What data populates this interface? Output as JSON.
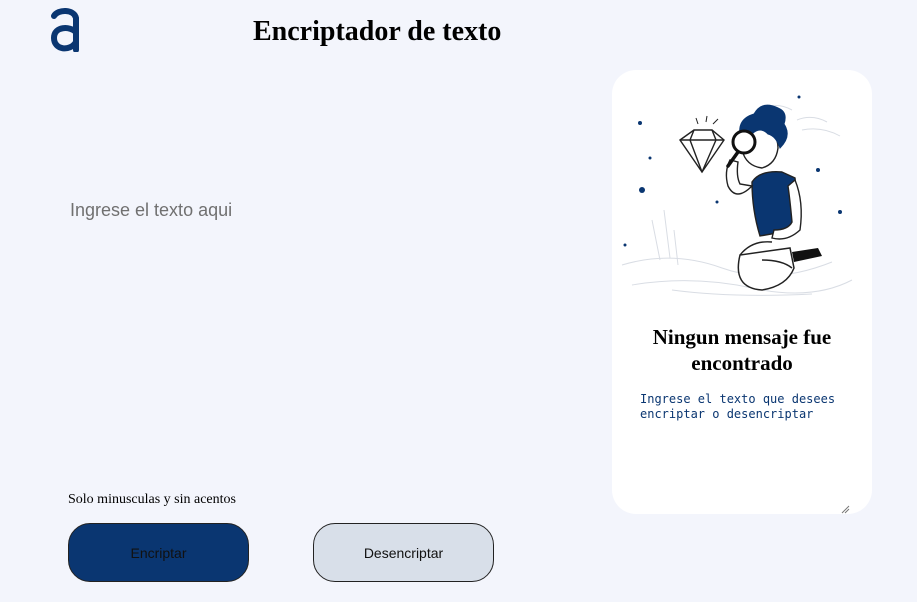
{
  "header": {
    "logo_icon": "alura-a-logo-icon",
    "title": "Encriptador de texto"
  },
  "input": {
    "placeholder": "Ingrese el texto aqui",
    "value": ""
  },
  "hint": "Solo minusculas y sin acentos",
  "buttons": {
    "encrypt_label": "Encriptar",
    "decrypt_label": "Desencriptar"
  },
  "output_card": {
    "illustration_icon": "boy-with-magnifying-glass-illustration",
    "title": "Ningun mensaje fue encontrado",
    "message": "Ingrese el texto que desees encriptar o desencriptar"
  },
  "colors": {
    "background": "#f3f5fc",
    "primary": "#0a3671",
    "secondary": "#d8dfe9",
    "card": "#ffffff"
  }
}
